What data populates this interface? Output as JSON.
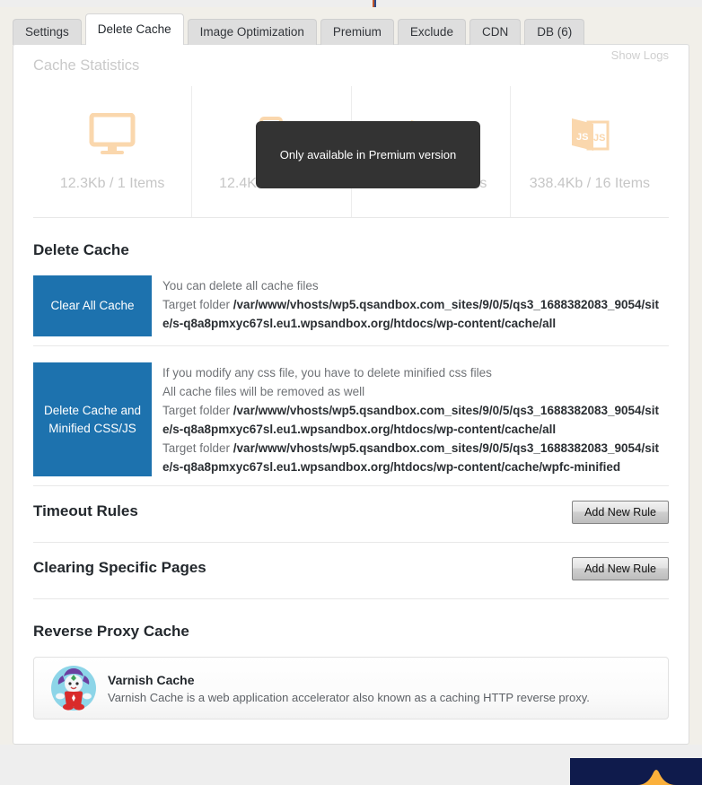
{
  "tabs": [
    {
      "label": "Settings",
      "active": false
    },
    {
      "label": "Delete Cache",
      "active": true
    },
    {
      "label": "Image Optimization",
      "active": false
    },
    {
      "label": "Premium",
      "active": false
    },
    {
      "label": "Exclude",
      "active": false
    },
    {
      "label": "CDN",
      "active": false
    },
    {
      "label": "DB (6)",
      "active": false
    }
  ],
  "statistics": {
    "title": "Cache Statistics",
    "show_logs": "Show Logs",
    "items": [
      {
        "icon": "desktop-icon",
        "label": "12.3Kb / 1 Items"
      },
      {
        "icon": "mobile-icon",
        "label": "12.4Kb / 1 Items"
      },
      {
        "icon": "css-files-icon",
        "label": "278.2Kb / 9 Items"
      },
      {
        "icon": "js-files-icon",
        "label": "338.4Kb / 16 Items"
      }
    ]
  },
  "tooltip": {
    "text": "Only available in Premium version"
  },
  "delete_cache": {
    "title": "Delete Cache",
    "rows": [
      {
        "button_label": "Clear All Cache",
        "lines": [
          {
            "text": "You can delete all cache files",
            "path": ""
          },
          {
            "text": "Target folder ",
            "path": "/var/www/vhosts/wp5.qsandbox.com_sites/9/0/5/qs3_1688382083_9054/site/s-q8a8pmxyc67sl.eu1.wpsandbox.org/htdocs/wp-content/cache/all"
          }
        ]
      },
      {
        "button_label": "Delete Cache and Minified CSS/JS",
        "lines": [
          {
            "text": "If you modify any css file, you have to delete minified css files",
            "path": ""
          },
          {
            "text": "All cache files will be removed as well",
            "path": ""
          },
          {
            "text": "Target folder ",
            "path": "/var/www/vhosts/wp5.qsandbox.com_sites/9/0/5/qs3_1688382083_9054/site/s-q8a8pmxyc67sl.eu1.wpsandbox.org/htdocs/wp-content/cache/all"
          },
          {
            "text": "Target folder ",
            "path": "/var/www/vhosts/wp5.qsandbox.com_sites/9/0/5/qs3_1688382083_9054/site/s-q8a8pmxyc67sl.eu1.wpsandbox.org/htdocs/wp-content/cache/wpfc-minified"
          }
        ]
      }
    ]
  },
  "timeout_rules": {
    "title": "Timeout Rules",
    "button_label": "Add New Rule"
  },
  "clearing_specific_pages": {
    "title": "Clearing Specific Pages",
    "button_label": "Add New Rule"
  },
  "reverse_proxy": {
    "title": "Reverse Proxy Cache",
    "varnish_name": "Varnish Cache",
    "varnish_desc": "Varnish Cache is a web application accelerator also known as a caching HTTP reverse proxy."
  },
  "colors": {
    "accent_blue": "#1d72ae",
    "icon_peach": "#fad7ad",
    "tooltip_bg": "#333333",
    "navy": "#0f1b4c",
    "orange": "#fbb03b"
  }
}
